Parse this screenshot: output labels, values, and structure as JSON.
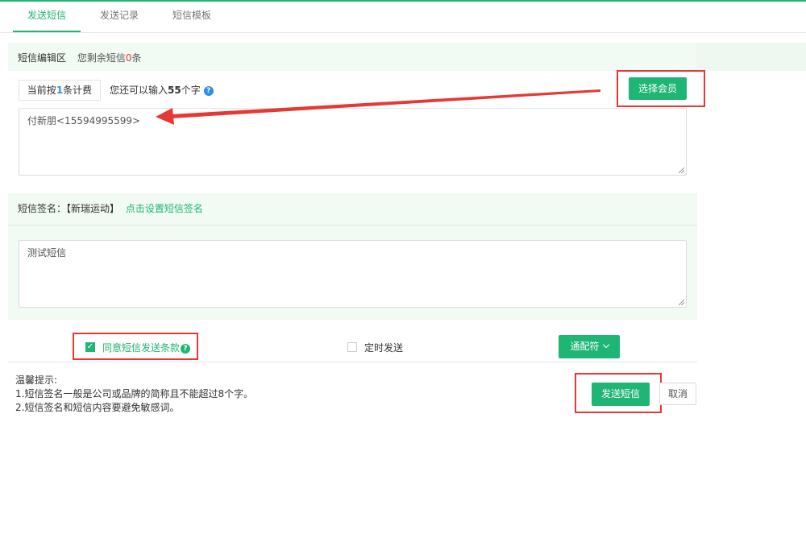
{
  "tabs": [
    {
      "label": "发送短信",
      "active": true
    },
    {
      "label": "发送记录",
      "active": false
    },
    {
      "label": "短信模板",
      "active": false
    }
  ],
  "editor": {
    "title": "短信编辑区",
    "remaining_prefix": "您剩余短信",
    "remaining_count": "0",
    "remaining_suffix": "条",
    "billing_prefix": "当前按",
    "billing_count": "1",
    "billing_suffix": "条计费",
    "input_prefix": "您还可以输入",
    "input_count": "55",
    "input_suffix": "个字",
    "select_member_label": "选择会员",
    "recipients_value": "付新朋<15594995599>"
  },
  "signature": {
    "label": "短信签名：",
    "value": "【新瑞运动】",
    "set_link": "点击设置短信签名",
    "message_value": "测试短信"
  },
  "options": {
    "agree_label": "同意短信发送条款",
    "agree_checked": true,
    "schedule_label": "定时发送",
    "schedule_checked": false,
    "wildcard_label": "通配符"
  },
  "tips": {
    "title": "温馨提示:",
    "line1": "1.短信签名一般是公司或品牌的简称且不能超过8个字。",
    "line2": "2.短信签名和短信内容要避免敏感词。"
  },
  "actions": {
    "send_label": "发送短信",
    "cancel_label": "取消"
  },
  "colors": {
    "accent": "#1fb574",
    "highlight_red": "#e53935",
    "info_blue": "#2a8fe6"
  }
}
